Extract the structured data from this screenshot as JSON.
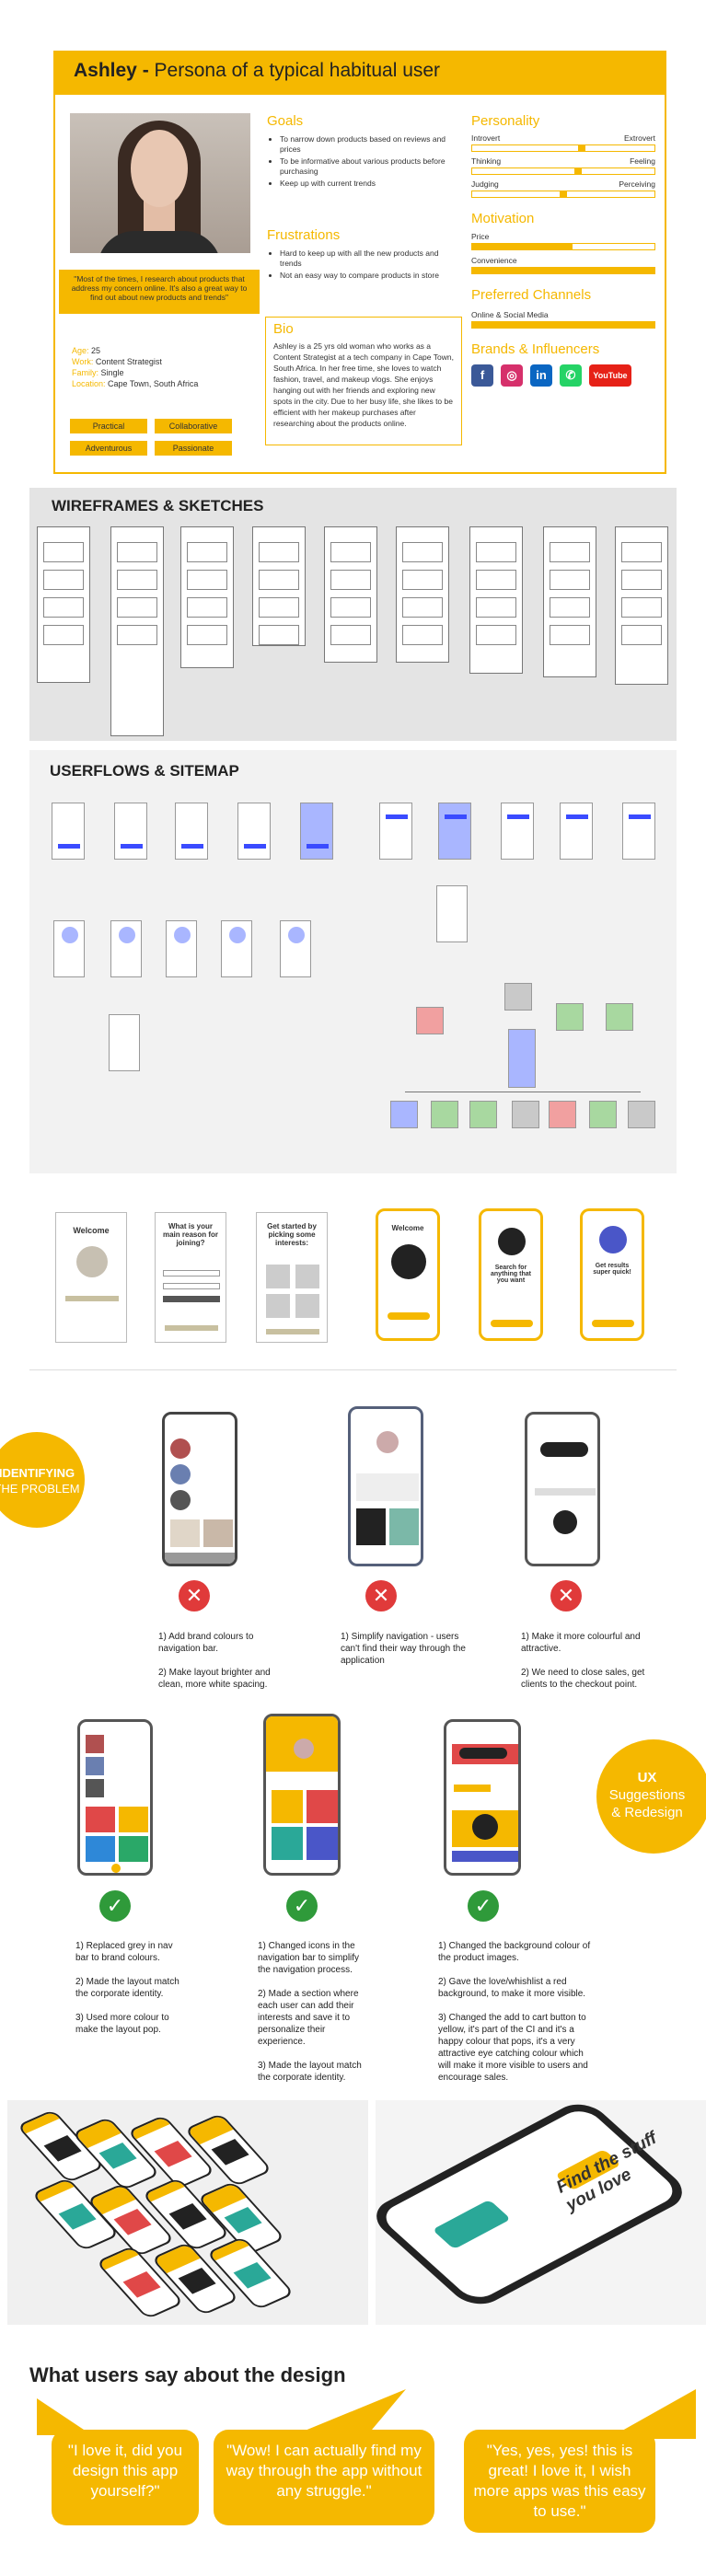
{
  "persona": {
    "name": "Ashley - ",
    "title_rest": "Persona of a typical habitual user",
    "quote": "\"Most of the times, I research about products that address my concern online. It's also a great way to find out about new products and trends\"",
    "meta": [
      {
        "key": "Age:",
        "value": "25"
      },
      {
        "key": "Work:",
        "value": "Content Strategist"
      },
      {
        "key": "Family:",
        "value": "Single"
      },
      {
        "key": "Location:",
        "value": "Cape Town, South Africa"
      }
    ],
    "tags": [
      "Practical",
      "Collaborative",
      "Adventurous",
      "Passionate"
    ],
    "goals_title": "Goals",
    "goals": [
      "To narrow down products based on reviews and prices",
      "To be informative about various products before purchasing",
      "Keep up with current trends"
    ],
    "frustrations_title": "Frustrations",
    "frustrations": [
      "Hard to keep up with all the new products and trends",
      "Not an easy way to compare products in store"
    ],
    "bio_title": "Bio",
    "bio": "Ashley is a 25 yrs old woman who works as a Content Strategist at a tech company in Cape Town, South Africa. In her free time, she loves to watch fashion, travel, and makeup vlogs. She enjoys hanging out with her friends and exploring new spots in the city. Due to her busy life, she likes to be efficient with her makeup purchases after researching about the products online.",
    "personality_title": "Personality",
    "personality": [
      {
        "left": "Introvert",
        "right": "Extrovert",
        "level": 0.6
      },
      {
        "left": "Thinking",
        "right": "Feeling",
        "level": 0.58
      },
      {
        "left": "Judging",
        "right": "Perceiving",
        "level": 0.5
      }
    ],
    "motivation_title": "Motivation",
    "motivation": [
      {
        "label": "Price",
        "level": 0.55
      },
      {
        "label": "Convenience",
        "level": 1.0
      }
    ],
    "channels_title": "Preferred Channels",
    "channels": [
      {
        "label": "Online & Social Media",
        "level": 1.0
      }
    ],
    "brands_title": "Brands & Influencers",
    "brands": [
      {
        "icon": "facebook-icon",
        "glyph": "f",
        "color": "#3b5998"
      },
      {
        "icon": "instagram-icon",
        "glyph": "◎",
        "color": "#d6306b"
      },
      {
        "icon": "linkedin-icon",
        "glyph": "in",
        "color": "#0a66c2"
      },
      {
        "icon": "whatsapp-icon",
        "glyph": "✆",
        "color": "#25d366"
      },
      {
        "icon": "youtube-icon",
        "glyph": "YouTube",
        "color": "#e62117"
      }
    ]
  },
  "sections": {
    "wireframes_title": "WIREFRAMES & SKETCHES",
    "userflows_title": "USERFLOWS & SITEMAP",
    "identifying_line1": "IDENTIFYING",
    "identifying_line2": "THE PROBLEM",
    "ux_line1": "UX",
    "ux_line2": "Suggestions",
    "ux_line3": "& Redesign",
    "testimonials_title": "What users say about the design"
  },
  "onboarding": {
    "welcome": "Welcome",
    "reason": "What is your main reason for joining?",
    "started": "Get started by picking some interests:",
    "search": "Search for anything that you want",
    "results": "Get results super quick!"
  },
  "problems": [
    "1) Add brand colours to navigation bar.\n\n2) Make layout brighter and clean, more white spacing.",
    "1) Simplify navigation - users can't find their way through the application",
    "1) Make it more colourful and attractive.\n\n2) We need to close sales, get clients to the checkout point."
  ],
  "solutions": [
    "1) Replaced grey in nav bar to brand colours.\n\n2) Made the layout match the corporate identity.\n\n3) Used more colour to make the layout pop.",
    "1)  Changed icons in the navigation bar to simplify the navigation process.\n\n2) Made a section where each user can add their interests and save it to personalize their experience.\n\n3) Made the layout match the corporate identity.",
    "1) Changed the background colour of the product images.\n\n2) Gave the love/whishlist a red background, to make it more visible.\n\n3) Changed the add to cart button to yellow, it's part of the CI and it's a happy colour that pops, it's a very attractive eye catching colour which will make it more visible to users and encourage sales."
  ],
  "mockup_text": "Find the stuff you love",
  "testimonials": [
    "\"I love it, did you design this app yourself?\"",
    "\"Wow! I can actually find my way through the app without any struggle.\"",
    "\"Yes, yes, yes! this is great! I love it, I wish more apps was this easy to use.\""
  ]
}
